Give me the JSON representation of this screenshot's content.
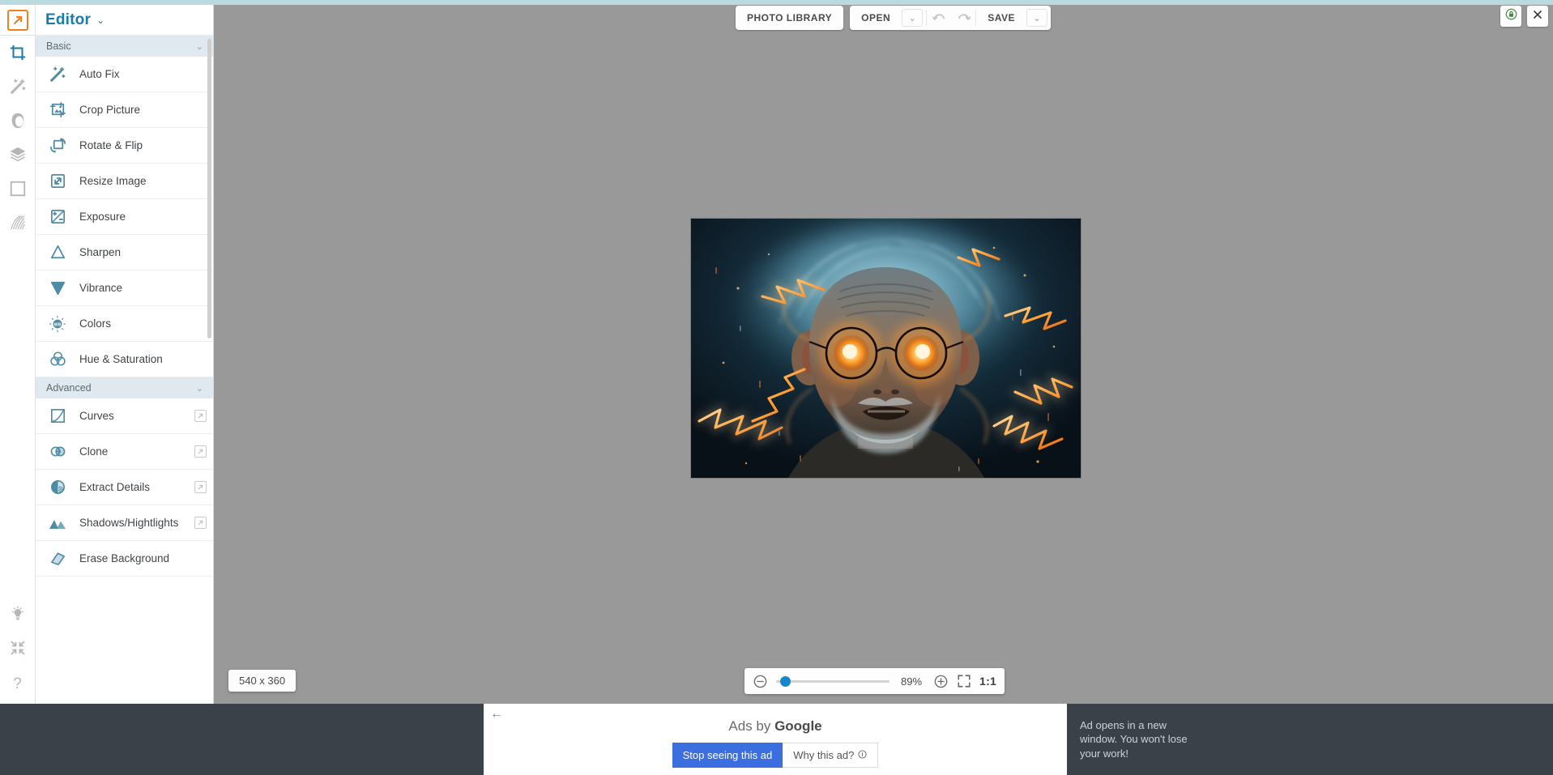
{
  "app": {
    "logo_icon": "arrow-box-logo",
    "title": "Editor",
    "title_caret": "⌄"
  },
  "colors": {
    "accent_blue": "#1b7ba5",
    "logo_orange": "#ef8022",
    "slider_blue": "#1787c8",
    "ad_blue": "#3b6fe0",
    "canvas_gray": "#999999",
    "ad_bar_dark": "#3b4149",
    "top_strip_teal": "#b9dbdd"
  },
  "rail": {
    "items": [
      {
        "icon": "crop-icon",
        "active": true
      },
      {
        "icon": "magic-wand-icon",
        "active": false
      },
      {
        "icon": "portrait-retouch-icon",
        "active": false
      },
      {
        "icon": "layers-icon",
        "active": false
      },
      {
        "icon": "frame-icon",
        "active": false
      },
      {
        "icon": "texture-icon",
        "active": false
      }
    ],
    "bottom_items": [
      {
        "icon": "lightbulb-icon"
      },
      {
        "icon": "collapse-arrows-icon"
      },
      {
        "icon": "help-question-icon"
      }
    ]
  },
  "panel": {
    "groups": [
      {
        "label": "Basic",
        "caret": "⌄",
        "items": [
          {
            "label": "Auto Fix",
            "icon": "magic-wand-icon",
            "pro": false
          },
          {
            "label": "Crop Picture",
            "icon": "crop-picture-icon",
            "pro": false
          },
          {
            "label": "Rotate & Flip",
            "icon": "rotate-flip-icon",
            "pro": false
          },
          {
            "label": "Resize Image",
            "icon": "resize-icon",
            "pro": false
          },
          {
            "label": "Exposure",
            "icon": "exposure-icon",
            "pro": false
          },
          {
            "label": "Sharpen",
            "icon": "sharpen-triangle-icon",
            "pro": false
          },
          {
            "label": "Vibrance",
            "icon": "vibrance-icon",
            "pro": false
          },
          {
            "label": "Colors",
            "icon": "white-balance-icon",
            "pro": false
          },
          {
            "label": "Hue & Saturation",
            "icon": "hue-saturation-icon",
            "pro": false
          }
        ]
      },
      {
        "label": "Advanced",
        "caret": "⌄",
        "items": [
          {
            "label": "Curves",
            "icon": "curves-icon",
            "pro": true
          },
          {
            "label": "Clone",
            "icon": "clone-icon",
            "pro": true
          },
          {
            "label": "Extract Details",
            "icon": "extract-details-icon",
            "pro": true
          },
          {
            "label": "Shadows/Hightlights",
            "icon": "shadows-highlights-icon",
            "pro": true
          },
          {
            "label": "Erase Background",
            "icon": "eraser-icon",
            "pro": false
          }
        ]
      }
    ]
  },
  "toolbar": {
    "photo_library_label": "PHOTO LIBRARY",
    "open_label": "OPEN",
    "open_caret": "⌄",
    "undo_icon": "undo-arrow-icon",
    "redo_icon": "redo-arrow-icon",
    "save_label": "SAVE",
    "save_caret": "⌄"
  },
  "top_right": {
    "lock_icon": "green-lock-icon",
    "close_icon": "close-x-icon"
  },
  "canvas": {
    "image_dimensions": "540 x 360",
    "image_alt": "elderly scientist with glowing orange eyes, wild white hair and orange electric arcs"
  },
  "zoom": {
    "minus_icon": "zoom-out-icon",
    "plus_icon": "zoom-in-icon",
    "fullscreen_icon": "fit-screen-icon",
    "percent": "89%",
    "slider_value": 89,
    "ratio_label": "1:1"
  },
  "ad": {
    "back_arrow": "←",
    "ads_by_prefix": "Ads by ",
    "ads_by_brand": "Google",
    "stop_label": "Stop seeing this ad",
    "why_label": "Why this ad?",
    "why_info_icon": "info-circle-icon",
    "note": "Ad opens in a new window. You won't lose your work!"
  }
}
